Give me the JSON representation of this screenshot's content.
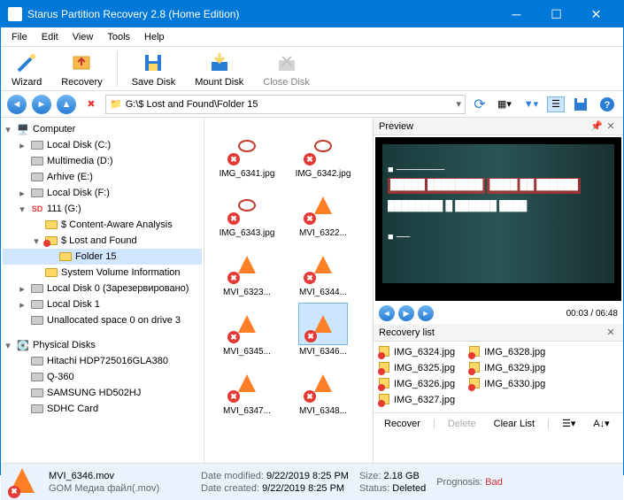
{
  "window": {
    "title": "Starus Partition Recovery 2.8 (Home Edition)"
  },
  "menu": [
    "File",
    "Edit",
    "View",
    "Tools",
    "Help"
  ],
  "toolbar": [
    {
      "label": "Wizard"
    },
    {
      "label": "Recovery"
    },
    {
      "label": "Save Disk"
    },
    {
      "label": "Mount Disk"
    },
    {
      "label": "Close Disk"
    }
  ],
  "address": "G:\\$ Lost and Found\\Folder 15",
  "tree": {
    "root": "Computer",
    "items": [
      {
        "label": "Local Disk (C:)",
        "indent": 1,
        "exp": "▸",
        "ico": "drive"
      },
      {
        "label": "Multimedia (D:)",
        "indent": 1,
        "exp": "",
        "ico": "drive"
      },
      {
        "label": "Arhive (E:)",
        "indent": 1,
        "exp": "",
        "ico": "drive"
      },
      {
        "label": "Local Disk (F:)",
        "indent": 1,
        "exp": "▸",
        "ico": "drive"
      },
      {
        "label": "111 (G:)",
        "indent": 1,
        "exp": "▾",
        "ico": "sd"
      },
      {
        "label": "$ Content-Aware Analysis",
        "indent": 2,
        "exp": "",
        "ico": "folder"
      },
      {
        "label": "$ Lost and Found",
        "indent": 2,
        "exp": "▾",
        "ico": "folderx"
      },
      {
        "label": "Folder 15",
        "indent": 3,
        "exp": "",
        "ico": "folder",
        "sel": true
      },
      {
        "label": "System Volume Information",
        "indent": 2,
        "exp": "",
        "ico": "folder"
      },
      {
        "label": "Local Disk 0 (Зарезервировано)",
        "indent": 1,
        "exp": "▸",
        "ico": "drive"
      },
      {
        "label": "Local Disk 1",
        "indent": 1,
        "exp": "▸",
        "ico": "drive"
      },
      {
        "label": "Unallocated space 0 on drive 3",
        "indent": 1,
        "exp": "",
        "ico": "drive"
      }
    ],
    "phys": "Physical Disks",
    "physItems": [
      {
        "label": "Hitachi HDP725016GLA380"
      },
      {
        "label": "Q-360"
      },
      {
        "label": "SAMSUNG HD502HJ"
      },
      {
        "label": "SDHC Card"
      }
    ]
  },
  "files": [
    {
      "name": "IMG_6341.jpg",
      "type": "img"
    },
    {
      "name": "IMG_6342.jpg",
      "type": "img"
    },
    {
      "name": "IMG_6343.jpg",
      "type": "img"
    },
    {
      "name": "MVI_6322...",
      "type": "vid"
    },
    {
      "name": "MVI_6323...",
      "type": "vid"
    },
    {
      "name": "MVI_6344...",
      "type": "vid"
    },
    {
      "name": "MVI_6345...",
      "type": "vid"
    },
    {
      "name": "MVI_6346...",
      "type": "vid",
      "sel": true
    },
    {
      "name": "MVI_6347...",
      "type": "vid"
    },
    {
      "name": "MVI_6348...",
      "type": "vid"
    }
  ],
  "preview": {
    "title": "Preview",
    "time": "00:03 / 06:48"
  },
  "recovery": {
    "title": "Recovery list",
    "items": [
      "IMG_6324.jpg",
      "IMG_6325.jpg",
      "IMG_6326.jpg",
      "IMG_6327.jpg",
      "IMG_6328.jpg",
      "IMG_6329.jpg",
      "IMG_6330.jpg"
    ],
    "buttons": {
      "recover": "Recover",
      "delete": "Delete",
      "clear": "Clear List"
    }
  },
  "status": {
    "filename": "MVI_6346.mov",
    "filetype": "GOM Медиа файл(.mov)",
    "modLabel": "Date modified:",
    "mod": "9/22/2019 8:25 PM",
    "creLabel": "Date created:",
    "cre": "9/22/2019 8:25 PM",
    "sizeLabel": "Size:",
    "size": "2.18 GB",
    "statusLabel": "Status:",
    "statusVal": "Deleted",
    "progLabel": "Prognosis:",
    "progVal": "Bad"
  }
}
